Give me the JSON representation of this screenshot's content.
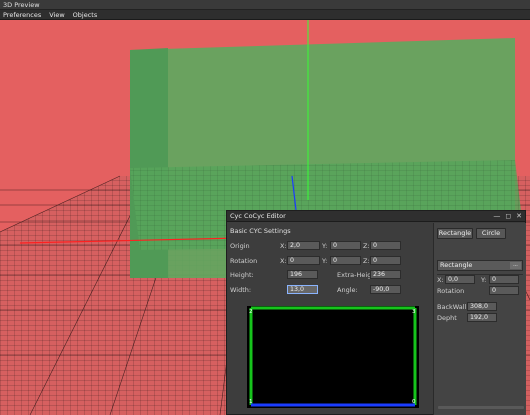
{
  "window": {
    "title": "3D Preview"
  },
  "menu": {
    "items": [
      "Preferences",
      "View",
      "Objects"
    ]
  },
  "colors": {
    "wall_red": "#e46060",
    "cyc_green": "#5fa860",
    "grid_line": "#000000",
    "axis_green": "#35ff35",
    "axis_red": "#ff2020",
    "axis_blue": "#1a3cff"
  },
  "editor": {
    "title": "Cyc CoCyc Editor",
    "window_buttons": [
      "—",
      "◻",
      "✕"
    ],
    "section_title": "Basic CYC Settings",
    "origin": {
      "label": "Origin",
      "x_label": "X:",
      "x": "2,0",
      "y_label": "Y:",
      "y": "0",
      "z_label": "Z:",
      "z": "0"
    },
    "rotation": {
      "label": "Rotation",
      "x_label": "X:",
      "x": "0",
      "y_label": "Y:",
      "y": "0",
      "z_label": "Z:",
      "z": "0"
    },
    "height": {
      "label": "Height:",
      "value": "196"
    },
    "extra_height": {
      "label": "Extra-Height:",
      "value": "236"
    },
    "width": {
      "label": "Width:",
      "value": "13,0"
    },
    "angle": {
      "label": "Angle:",
      "value": "-90,0"
    },
    "canvas": {
      "corner_tl": "2",
      "corner_tr": "3",
      "corner_bl": "1",
      "corner_br": "0"
    },
    "right": {
      "rectangle_button": "Rectangle",
      "circle_button": "Circle",
      "shape_select": "Rectangle",
      "combo_button": "...",
      "x_label": "X:",
      "x": "0,0",
      "y_label": "Y:",
      "y": "0",
      "rotation_label": "Rotation",
      "rotation": "0",
      "backwall_label": "BackWall",
      "backwall": "308,0",
      "depth_label": "Depht",
      "depth": "192,0"
    }
  }
}
